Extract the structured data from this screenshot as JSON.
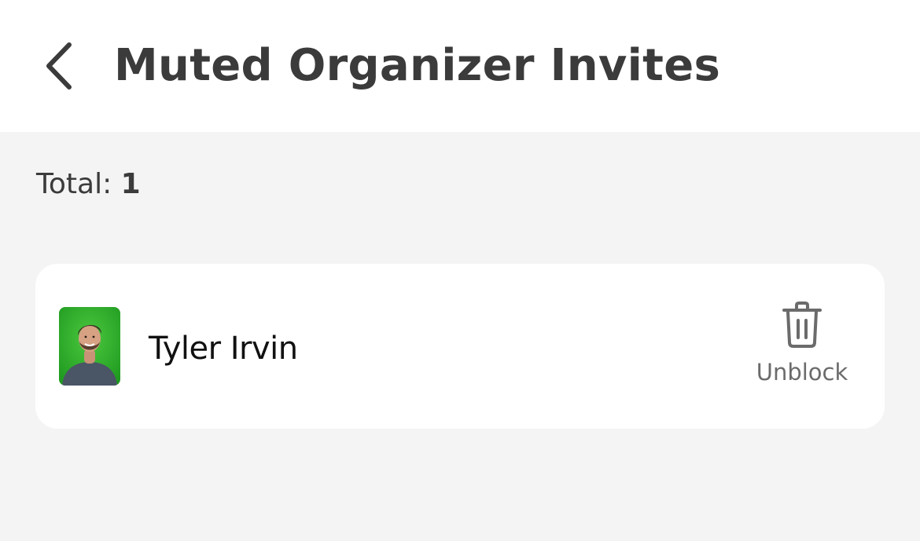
{
  "header": {
    "title": "Muted Organizer Invites",
    "back_icon": "chevron-left-icon"
  },
  "summary": {
    "total_label": "Total:",
    "total_count": "1"
  },
  "muted_list": [
    {
      "name": "Tyler Irvin",
      "avatar_background": "#2faa2a",
      "action_label": "Unblock",
      "action_icon": "trash-icon"
    }
  ]
}
